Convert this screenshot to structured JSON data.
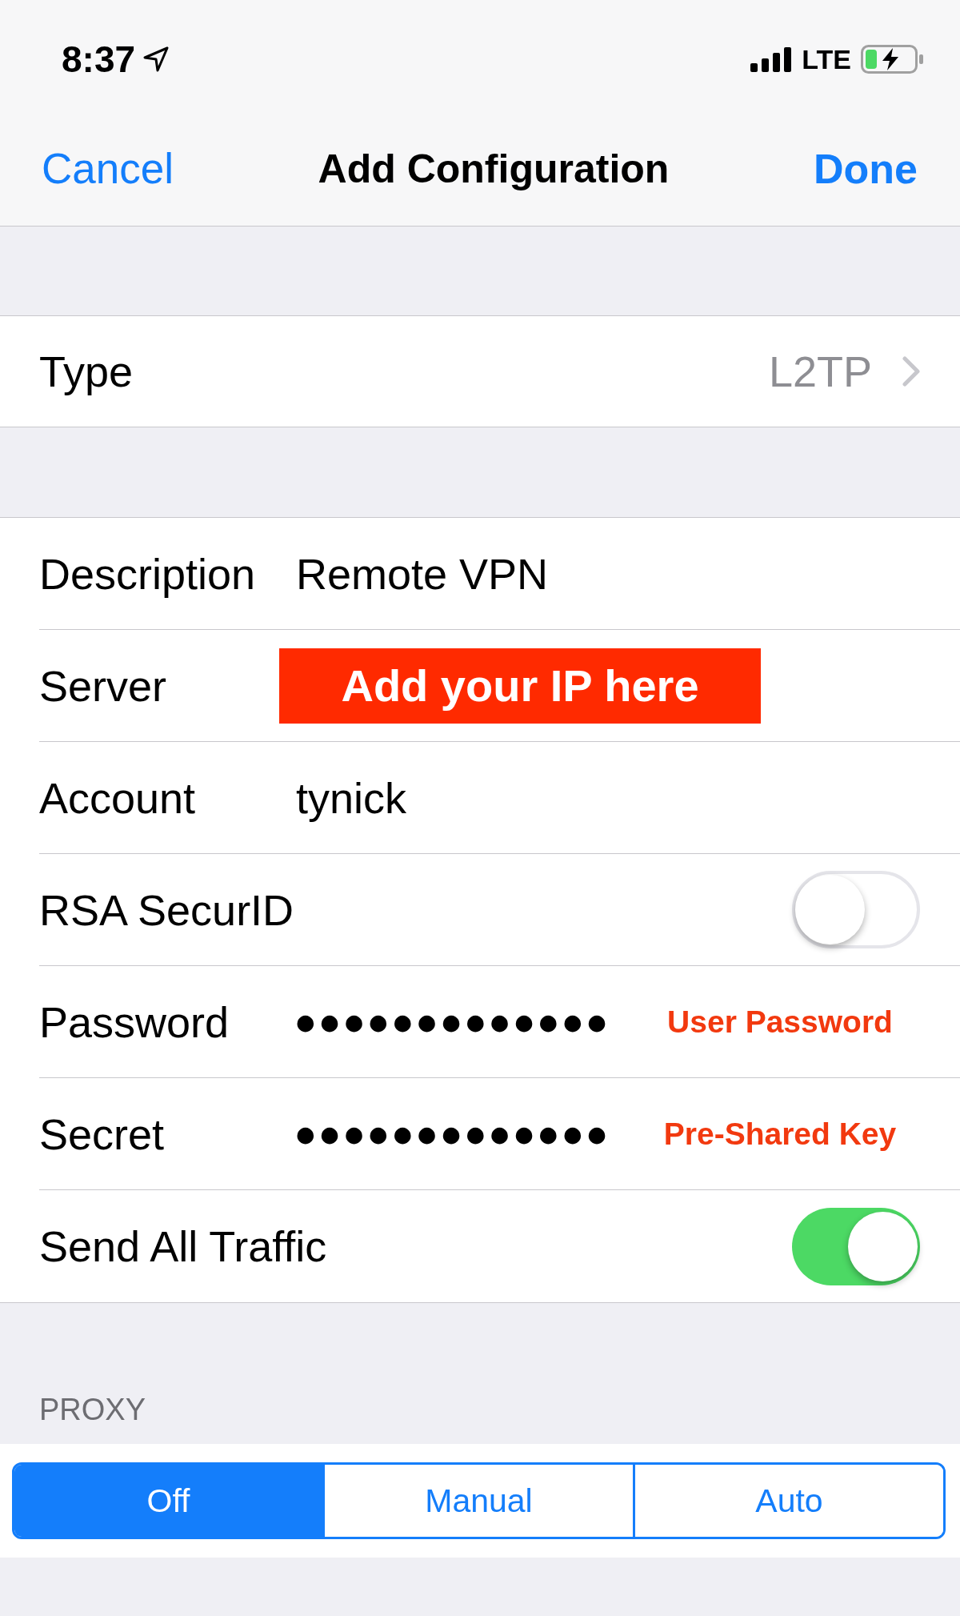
{
  "status_bar": {
    "time": "8:37",
    "network": "LTE"
  },
  "nav_bar": {
    "cancel": "Cancel",
    "title": "Add Configuration",
    "done": "Done"
  },
  "type_row": {
    "label": "Type",
    "value": "L2TP"
  },
  "fields": [
    {
      "kind": "text",
      "label": "Description",
      "value": "Remote VPN"
    },
    {
      "kind": "banner",
      "label": "Server",
      "annotation": "Add your IP here"
    },
    {
      "kind": "text",
      "label": "Account",
      "value": "tynick"
    },
    {
      "kind": "toggle",
      "label": "RSA SecurID",
      "on": false
    },
    {
      "kind": "secure",
      "label": "Password",
      "value": "●●●●●●●●●●●●●",
      "annotation": "User Password"
    },
    {
      "kind": "secure",
      "label": "Secret",
      "value": "●●●●●●●●●●●●●",
      "annotation": "Pre-Shared Key"
    },
    {
      "kind": "toggle",
      "label": "Send All Traffic",
      "on": true
    }
  ],
  "proxy": {
    "header": "PROXY",
    "options": [
      {
        "label": "Off",
        "selected": true
      },
      {
        "label": "Manual",
        "selected": false
      },
      {
        "label": "Auto",
        "selected": false
      }
    ]
  }
}
